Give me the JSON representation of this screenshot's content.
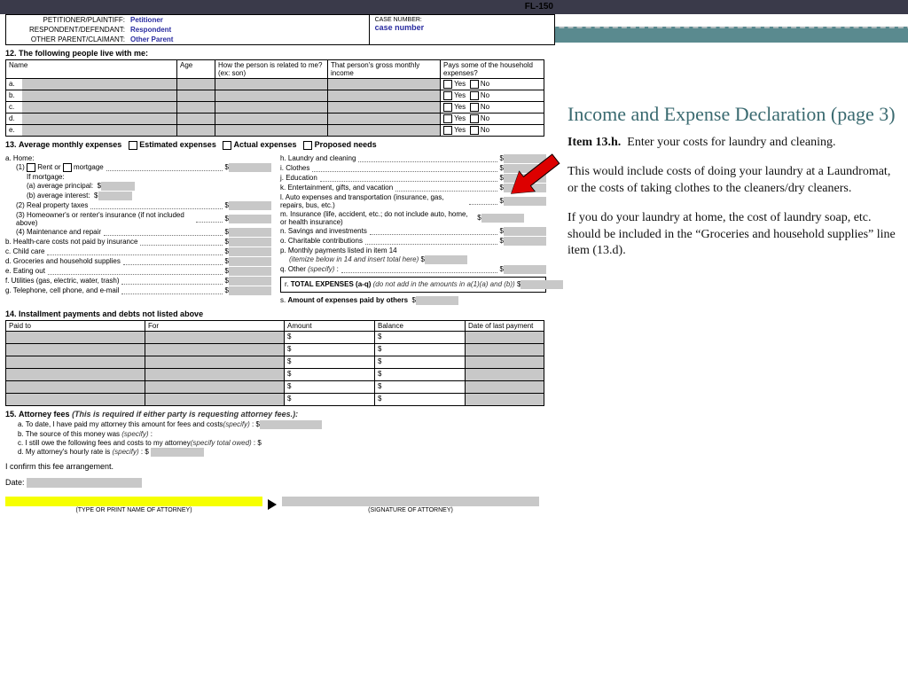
{
  "form_id": "FL-150",
  "header": {
    "petitioner_lbl": "PETITIONER/PLAINTIFF:",
    "petitioner": "Petitioner",
    "respondent_lbl": "RESPONDENT/DEFENDANT:",
    "respondent": "Respondent",
    "other_lbl": "OTHER PARENT/CLAIMANT:",
    "other": "Other Parent",
    "case_lbl": "CASE NUMBER:",
    "case": "case number"
  },
  "sec12": {
    "num": "12.",
    "title": "The following people live with me:",
    "cols": [
      "Name",
      "Age",
      "How the person is related to me? (ex: son)",
      "That person's gross monthly income",
      "Pays some of the household expenses?"
    ],
    "rows": [
      "a.",
      "b.",
      "c.",
      "d.",
      "e."
    ],
    "yes": "Yes",
    "no": "No"
  },
  "sec13": {
    "num": "13.",
    "title": "Average monthly expenses",
    "opts": [
      "Estimated expenses",
      "Actual expenses",
      "Proposed needs"
    ],
    "left": {
      "a": "a. Home:",
      "a1": "(1)",
      "rent": "Rent or",
      "mort": "mortgage",
      "ifmort": "If mortgage:",
      "ap": "(a)   average principal:",
      "ai": "(b)   average interest:",
      "a2": "(2) Real property taxes",
      "a3": "(3) Homeowner's or renter's insurance (if not included above)",
      "a4": "(4) Maintenance and repair",
      "b": "b. Health-care costs not paid by insurance",
      "c": "c. Child care",
      "d": "d. Groceries and household supplies",
      "e": "e. Eating out",
      "f": "f. Utilities (gas, electric, water, trash)",
      "g": "g. Telephone, cell phone, and e-mail"
    },
    "right": {
      "h": "h. Laundry and cleaning",
      "i": "i. Clothes",
      "j": "j. Education",
      "k": "k. Entertainment, gifts, and vacation",
      "l": "l. Auto expenses and transportation (insurance, gas, repairs, bus, etc.)",
      "m": "m. Insurance (life, accident, etc.; do not include auto, home, or health insurance)",
      "n": "n. Savings and investments",
      "o": "o. Charitable contributions",
      "p": "p. Monthly payments listed in item 14",
      "p2": "(itemize below in 14 and insert total here)",
      "q": "q. Other",
      "qspec": "(specify)",
      "r": "r.",
      "rtxt": "TOTAL EXPENSES (a-q)",
      "rnote": "(do not add in the amounts in a(1)(a) and (b))",
      "s": "s.",
      "stxt": "Amount of expenses paid by others"
    },
    "dollar": "$"
  },
  "sec14": {
    "num": "14.",
    "title": "Installment payments and debts not listed above",
    "cols": [
      "Paid to",
      "For",
      "Amount",
      "Balance",
      "Date of last payment"
    ],
    "rows": 6,
    "dollar": "$"
  },
  "sec15": {
    "num": "15.",
    "title": "Attorney fees",
    "note": "(This is required if either party is requesting attorney fees.):",
    "a": "a.   To date, I have paid my attorney this amount for fees and costs",
    "spec": "(specify)",
    "b": "b.   The source of this money was",
    "c": "c.   I still owe the following fees and costs to my attorney",
    "cnote": "(specify total owed)",
    "d": "d.   My attorney's hourly rate is",
    "confirm": "I confirm this fee arrangement.",
    "date": "Date:",
    "capL": "(TYPE OR PRINT NAME OF ATTORNEY)",
    "capR": "(SIGNATURE OF ATTORNEY)"
  },
  "side": {
    "title": "Income and Expense Declaration (page 3)",
    "item": "Item 13.h.",
    "p1": "Enter your costs for laundry and cleaning.",
    "p2": "This would include costs of doing your laundry at a Laundromat, or the costs of taking clothes to the cleaners/dry cleaners.",
    "p3": "If you do your laundry at home, the cost of laundry soap, etc. should be included in the “Groceries and household supplies” line item (13.d)."
  }
}
